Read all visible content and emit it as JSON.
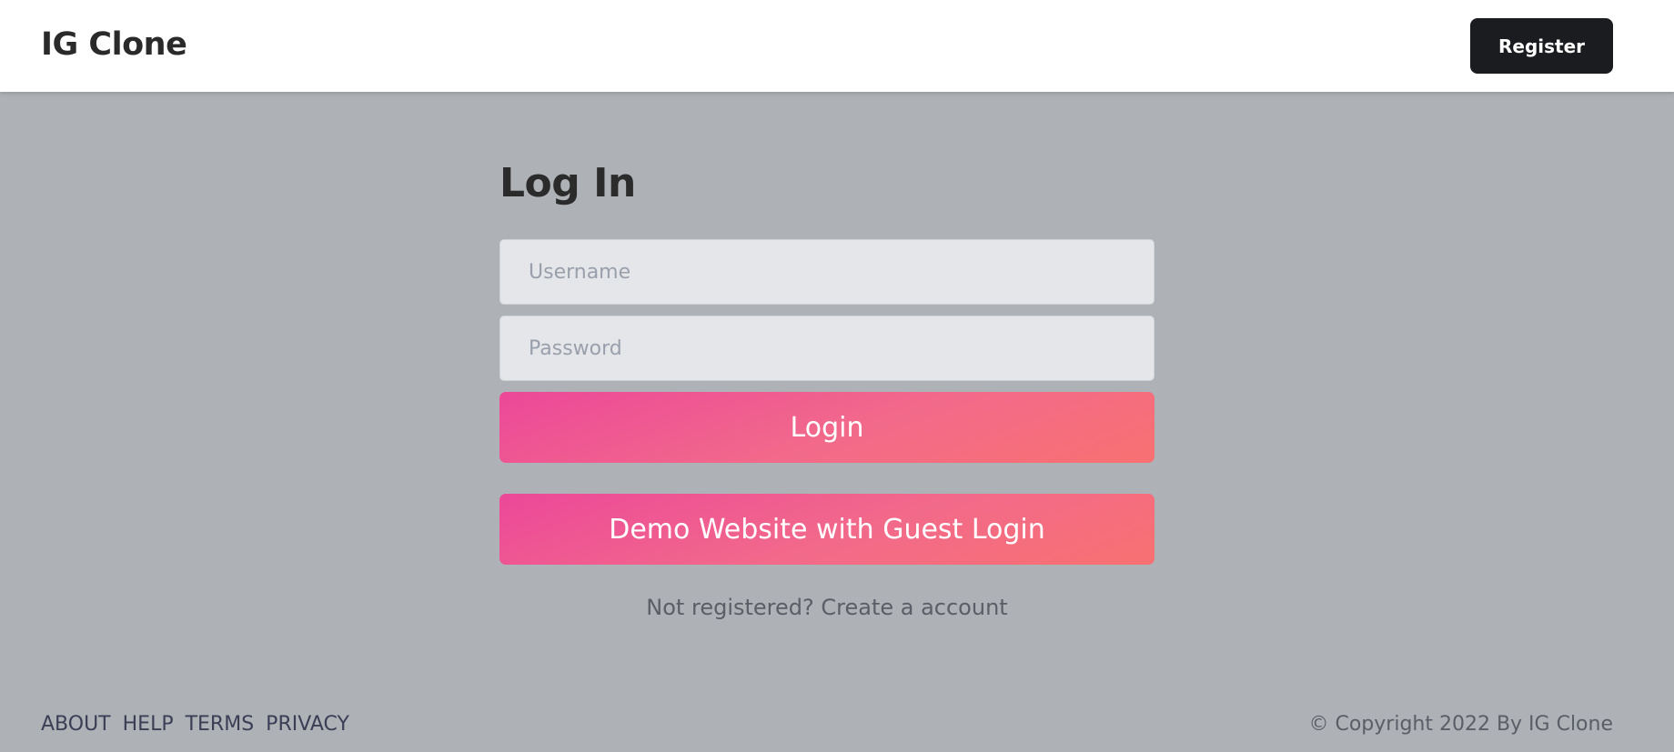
{
  "header": {
    "brand": "IG Clone",
    "register_label": "Register"
  },
  "login": {
    "title": "Log In",
    "username_placeholder": "Username",
    "password_placeholder": "Password",
    "login_label": "Login",
    "demo_label": "Demo Website with Guest Login",
    "register_prompt": "Not registered? Create a account"
  },
  "footer": {
    "links": [
      "ABOUT",
      "HELP",
      "TERMS",
      "PRIVACY"
    ],
    "copyright": "© Copyright 2022 By IG Clone"
  },
  "colors": {
    "page_background": "#aeb1b6",
    "header_background": "#ffffff",
    "register_button": "#1b1c20",
    "gradient_start": "#ec4899",
    "gradient_end": "#f87171"
  }
}
